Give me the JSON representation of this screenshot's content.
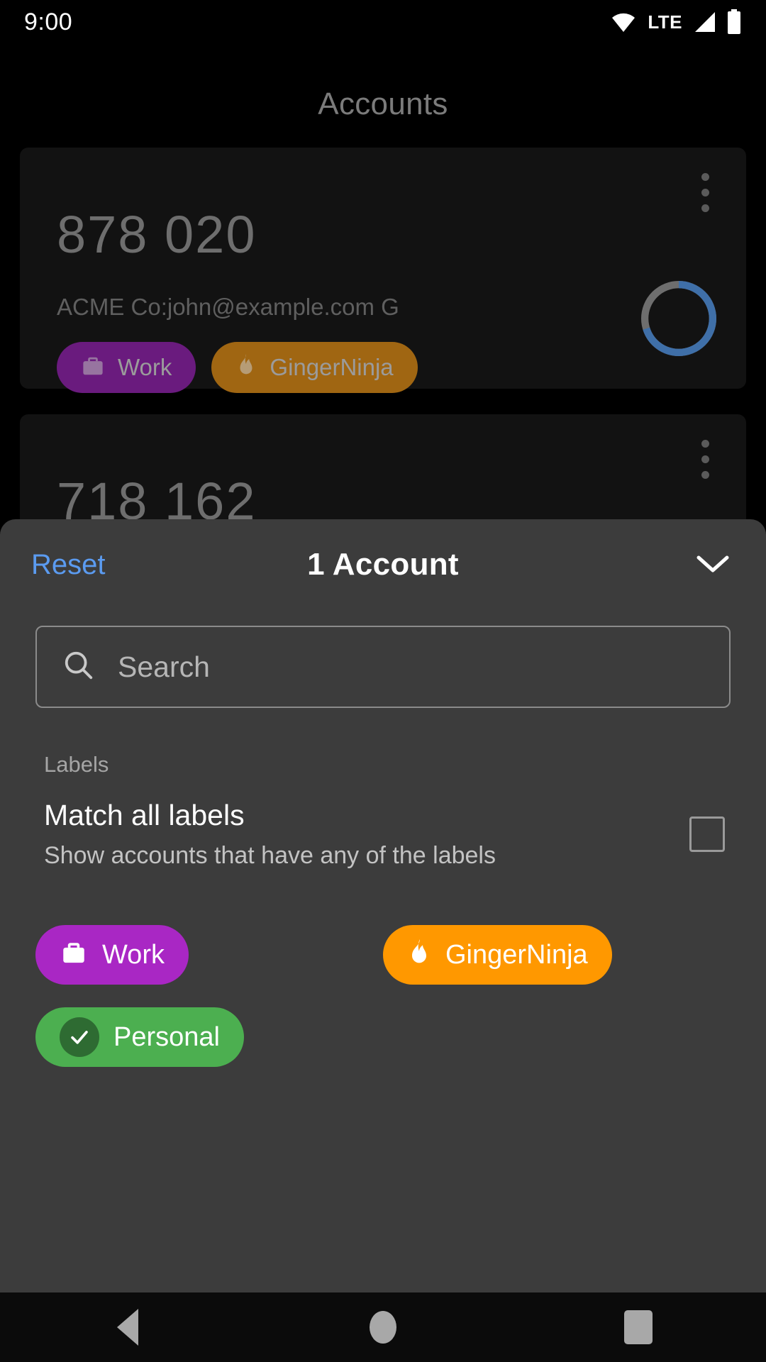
{
  "status_bar": {
    "time": "9:00",
    "network_type": "LTE",
    "icons": [
      "wifi-icon",
      "lte-label",
      "signal-icon",
      "battery-icon"
    ]
  },
  "app": {
    "title": "Accounts",
    "accounts": [
      {
        "code": "878 020",
        "issuer_account": "ACME Co:john@example.com G",
        "labels": [
          {
            "name": "Work",
            "color": "#6a1b7e",
            "icon": "briefcase-icon"
          },
          {
            "name": "GingerNinja",
            "color": "#a06612",
            "icon": "flame-icon"
          }
        ],
        "menu_icon": "overflow-menu-icon",
        "timer_icon": "countdown-ring"
      },
      {
        "code": "718 162",
        "issuer_account": "",
        "labels": [],
        "menu_icon": "overflow-menu-icon",
        "timer_icon": "countdown-ring"
      }
    ]
  },
  "sheet": {
    "reset_label": "Reset",
    "title": "1 Account",
    "collapse_icon": "chevron-down-icon",
    "search": {
      "placeholder": "Search",
      "value": "",
      "icon": "search-icon"
    },
    "labels_section": {
      "heading": "Labels",
      "match_all": {
        "title": "Match all labels",
        "subtitle": "Show accounts that have any of the labels",
        "checked": false
      },
      "chips": [
        {
          "name": "Work",
          "color": "#a927c4",
          "icon": "briefcase-icon",
          "selected": false
        },
        {
          "name": "GingerNinja",
          "color": "#ff9800",
          "icon": "flame-icon",
          "selected": false
        },
        {
          "name": "Personal",
          "color": "#4caf50",
          "icon": "check-icon",
          "selected": true
        }
      ]
    }
  },
  "nav_bar": {
    "back": "back-button",
    "home": "home-button",
    "recents": "recents-button"
  },
  "colors": {
    "accent_link": "#5b9bf0",
    "sheet_bg": "#3c3c3c",
    "card_bg": "#121212",
    "timer_arc": "#3f6fa8"
  }
}
